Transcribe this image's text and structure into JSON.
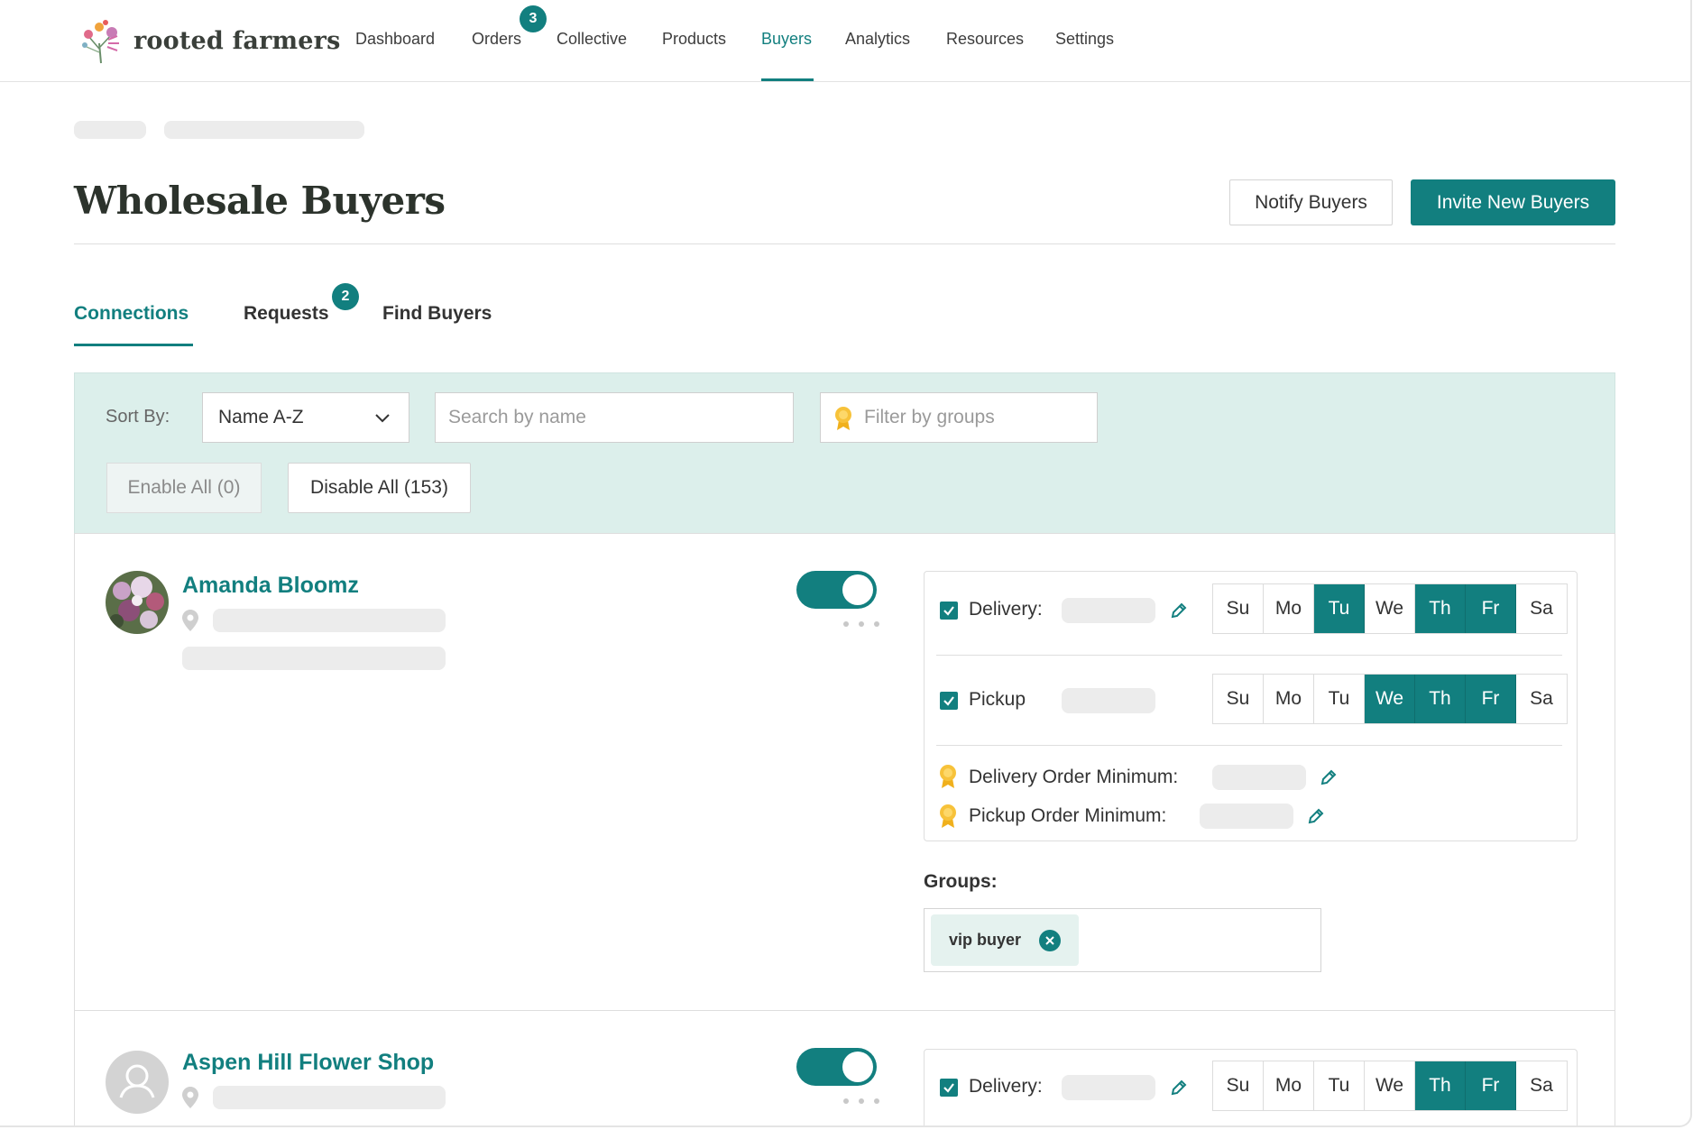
{
  "brand": {
    "name": "rooted farmers"
  },
  "nav": {
    "items": [
      {
        "label": "Dashboard"
      },
      {
        "label": "Orders",
        "badge": "3"
      },
      {
        "label": "Collective"
      },
      {
        "label": "Products"
      },
      {
        "label": "Buyers",
        "active": true
      },
      {
        "label": "Analytics"
      },
      {
        "label": "Resources"
      },
      {
        "label": "Settings"
      }
    ]
  },
  "page": {
    "title": "Wholesale Buyers",
    "notify_label": "Notify Buyers",
    "invite_label": "Invite New Buyers"
  },
  "tabs": [
    {
      "label": "Connections",
      "active": true
    },
    {
      "label": "Requests",
      "badge": "2"
    },
    {
      "label": "Find Buyers"
    }
  ],
  "filters": {
    "sort_label": "Sort By:",
    "sort_value": "Name A-Z",
    "search_placeholder": "Search by name",
    "groups_placeholder": "Filter by groups",
    "enable_all_label": "Enable All (0)",
    "disable_all_label": "Disable All (153)"
  },
  "day_labels": [
    "Su",
    "Mo",
    "Tu",
    "We",
    "Th",
    "Fr",
    "Sa"
  ],
  "buyers": [
    {
      "name": "Amanda Bloomz",
      "enabled": true,
      "delivery_label": "Delivery:",
      "pickup_label": "Pickup",
      "delivery_days": [
        "Tu",
        "Th",
        "Fr"
      ],
      "pickup_days": [
        "We",
        "Th",
        "Fr"
      ],
      "delivery_min_label": "Delivery Order Minimum:",
      "pickup_min_label": "Pickup Order Minimum:",
      "groups_label": "Groups:",
      "groups": [
        "vip buyer"
      ]
    },
    {
      "name": "Aspen Hill Flower Shop",
      "enabled": true,
      "delivery_label": "Delivery:",
      "delivery_days": [
        "Th",
        "Fr"
      ]
    }
  ],
  "colors": {
    "accent": "#127f7f",
    "band": "#dcefeb",
    "ribbon": "#f5b91e"
  }
}
